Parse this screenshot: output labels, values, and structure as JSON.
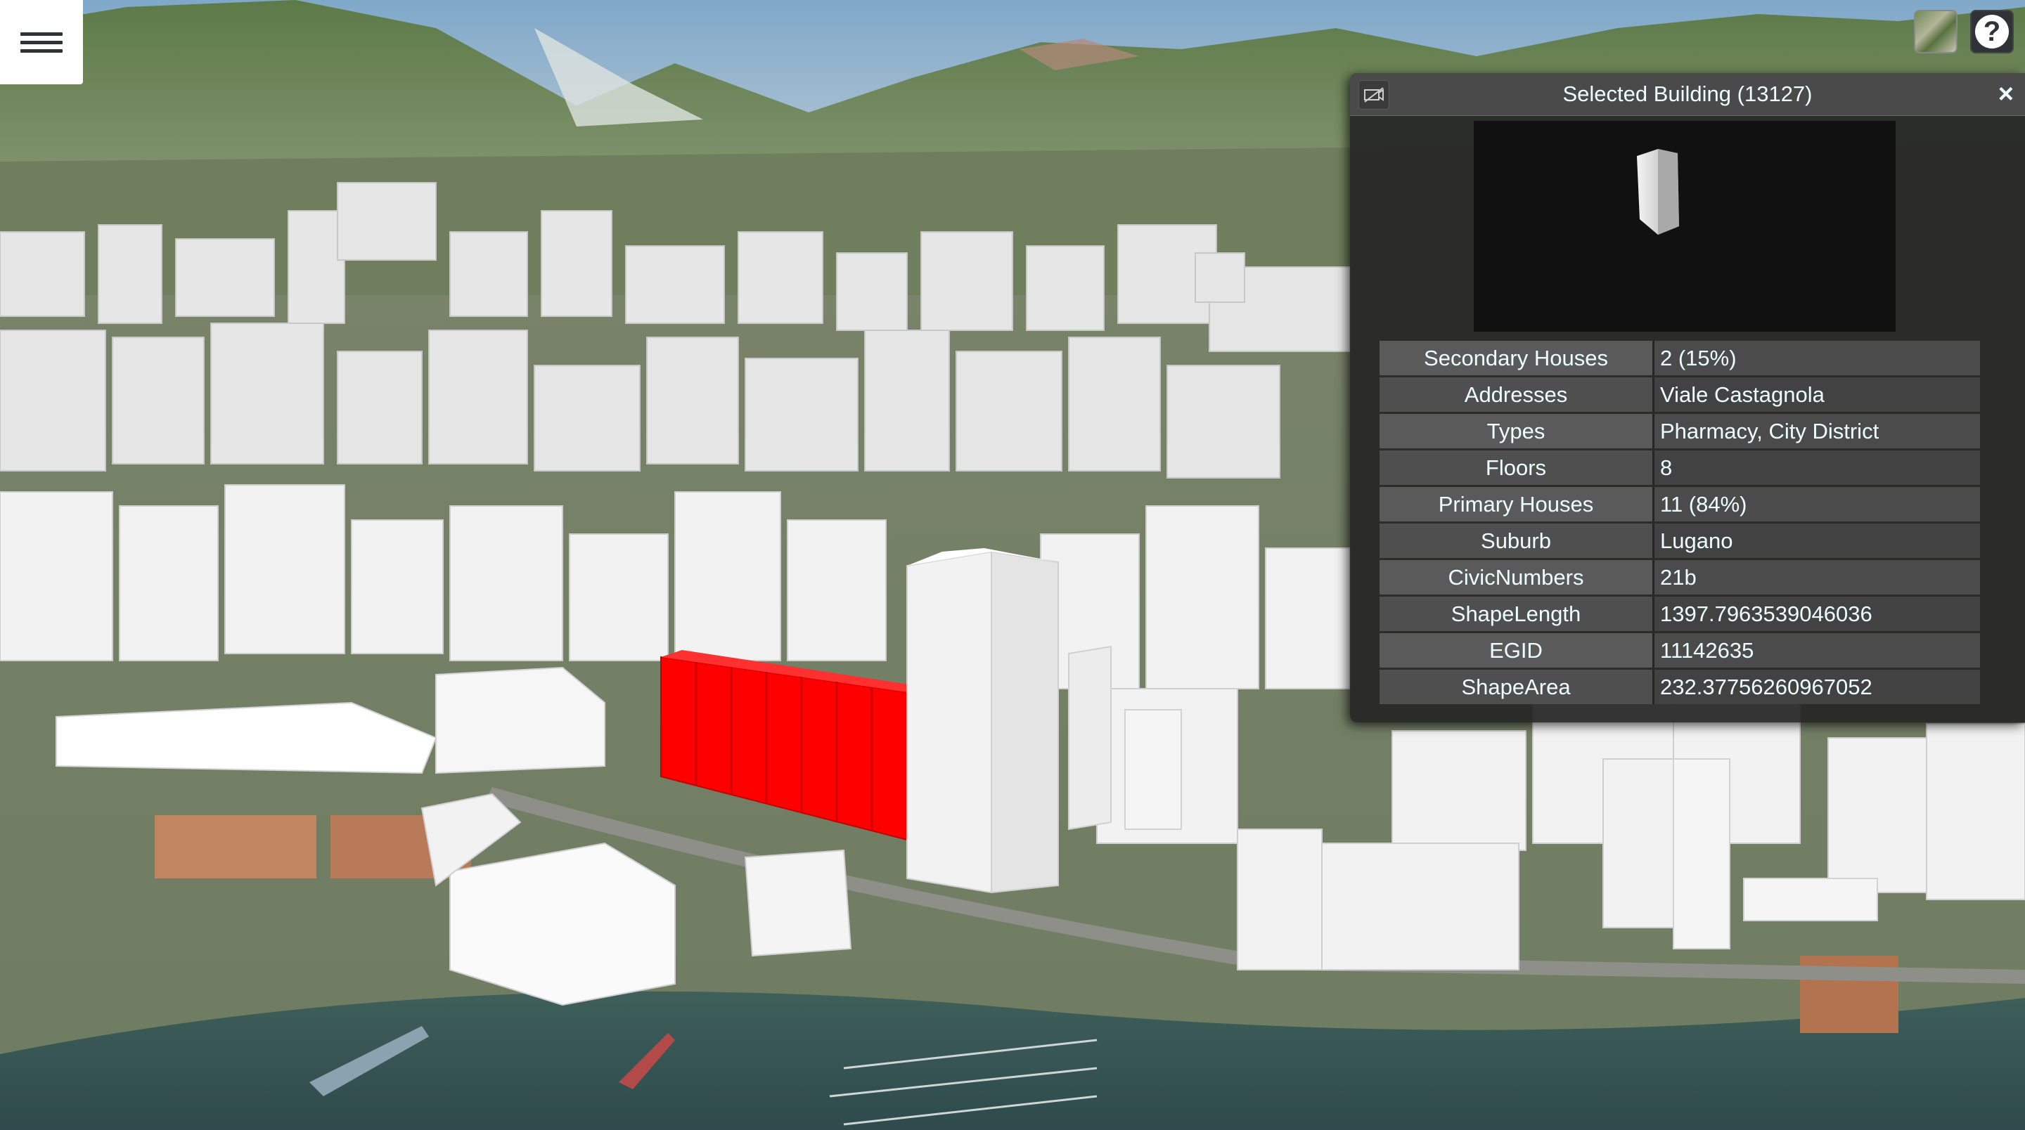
{
  "menu": {
    "icon": "hamburger-icon"
  },
  "toolbar": {
    "layer_icon": "base-layer-picker-icon",
    "help_label": "?"
  },
  "infobox": {
    "title": "Selected Building (13127)",
    "camera_icon": "camera-lock-icon",
    "close_label": "×",
    "rows": [
      {
        "key": "Secondary Houses",
        "value": "2 (15%)"
      },
      {
        "key": "Addresses",
        "value": "Viale Castagnola"
      },
      {
        "key": "Types",
        "value": "Pharmacy, City District"
      },
      {
        "key": "Floors",
        "value": "8"
      },
      {
        "key": "Primary Houses",
        "value": "11 (84%)"
      },
      {
        "key": "Suburb",
        "value": "Lugano"
      },
      {
        "key": "CivicNumbers",
        "value": "21b"
      },
      {
        "key": "ShapeLength",
        "value": "1397.7963539046036"
      },
      {
        "key": "EGID",
        "value": "11142635"
      },
      {
        "key": "ShapeArea",
        "value": "232.37756260967052"
      }
    ]
  },
  "colors": {
    "selected_building": "#ff0000",
    "building": "#f4f4f4",
    "panel_bg": "#262626",
    "panel_text": "#edffff"
  }
}
